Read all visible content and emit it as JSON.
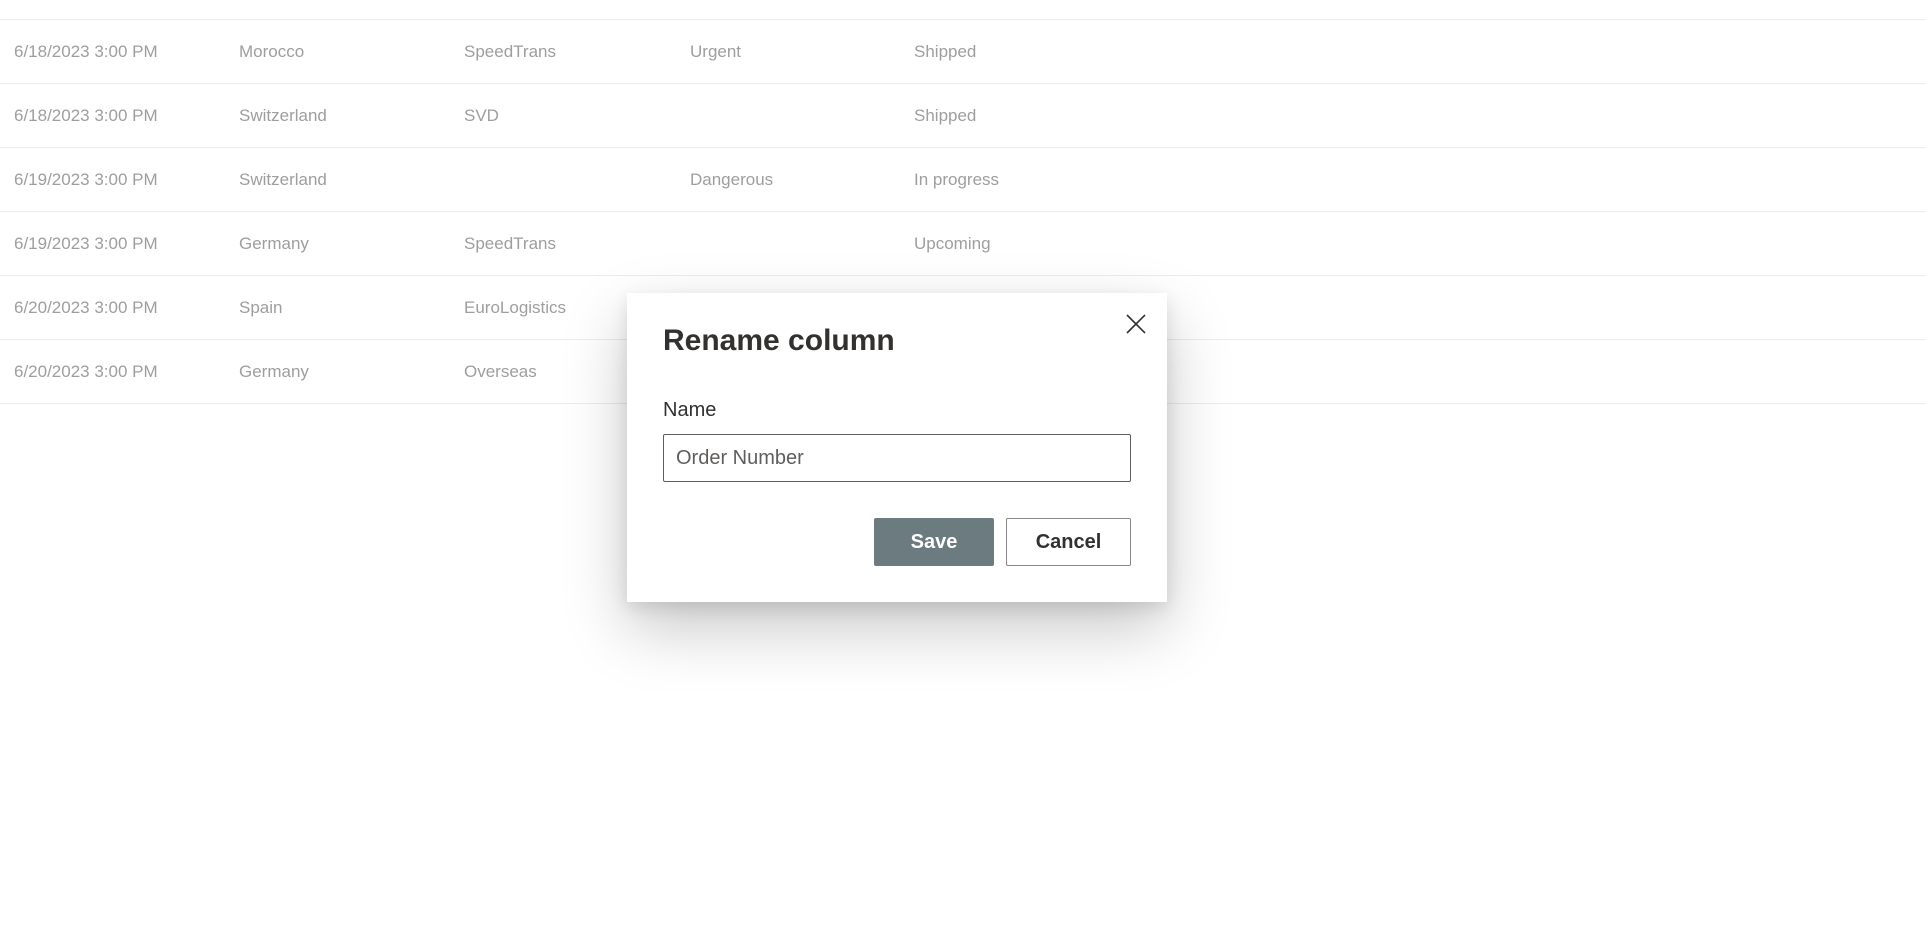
{
  "table": {
    "rows": [
      {
        "date": "6/18/2023 3:00 PM",
        "country": "Morocco",
        "carrier": "SpeedTrans",
        "flag": "Urgent",
        "status": "Shipped"
      },
      {
        "date": "6/18/2023 3:00 PM",
        "country": "Switzerland",
        "carrier": "SVD",
        "flag": "",
        "status": "Shipped"
      },
      {
        "date": "6/19/2023 3:00 PM",
        "country": "Switzerland",
        "carrier": "",
        "flag": "Dangerous",
        "status": "In progress"
      },
      {
        "date": "6/19/2023 3:00 PM",
        "country": "Germany",
        "carrier": "SpeedTrans",
        "flag": "",
        "status": "Upcoming"
      },
      {
        "date": "6/20/2023 3:00 PM",
        "country": "Spain",
        "carrier": "EuroLogistics",
        "flag": "",
        "status": ""
      },
      {
        "date": "6/20/2023 3:00 PM",
        "country": "Germany",
        "carrier": "Overseas",
        "flag": "",
        "status": ""
      }
    ]
  },
  "dialog": {
    "title": "Rename column",
    "close_icon": "close-icon",
    "name_label": "Name",
    "name_value": "Order Number",
    "save_label": "Save",
    "cancel_label": "Cancel"
  },
  "colors": {
    "save_button_bg": "#6b7b80",
    "row_text": "#9e9e9e",
    "divider": "#ececec"
  }
}
